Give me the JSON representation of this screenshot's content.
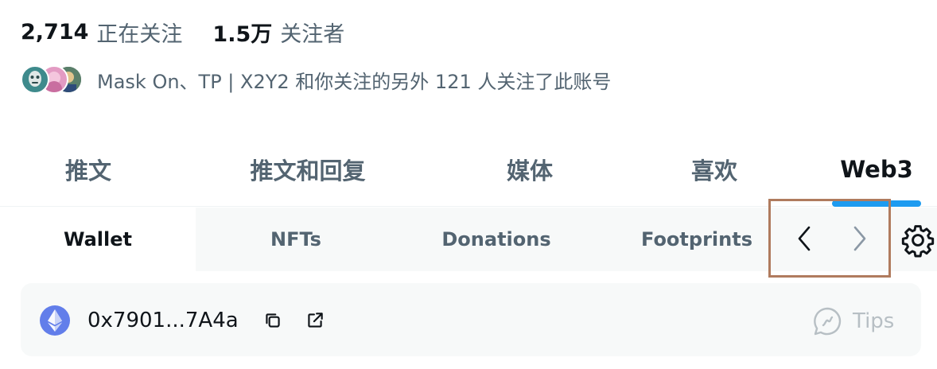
{
  "stats": {
    "following_count": "2,714",
    "following_label": "正在关注",
    "followers_count": "1.5万",
    "followers_label": "关注者"
  },
  "followers_you_know": {
    "text": "Mask On、TP | X2Y2 和你关注的另外 121 人关注了此账号"
  },
  "profile_tabs": [
    {
      "label": "推文"
    },
    {
      "label": "推文和回复"
    },
    {
      "label": "媒体"
    },
    {
      "label": "喜欢"
    },
    {
      "label": "Web3",
      "active": true
    }
  ],
  "web3_tabs": [
    {
      "label": "Wallet",
      "active": true
    },
    {
      "label": "NFTs"
    },
    {
      "label": "Donations"
    },
    {
      "label": "Footprints"
    }
  ],
  "wallet": {
    "address": "0x7901...7A4a",
    "tips_label": "Tips",
    "chain_icon": "ethereum-icon"
  },
  "colors": {
    "accent": "#1d9bf0",
    "ethereum": "#627eea",
    "highlight_box": "#b07b5e"
  }
}
